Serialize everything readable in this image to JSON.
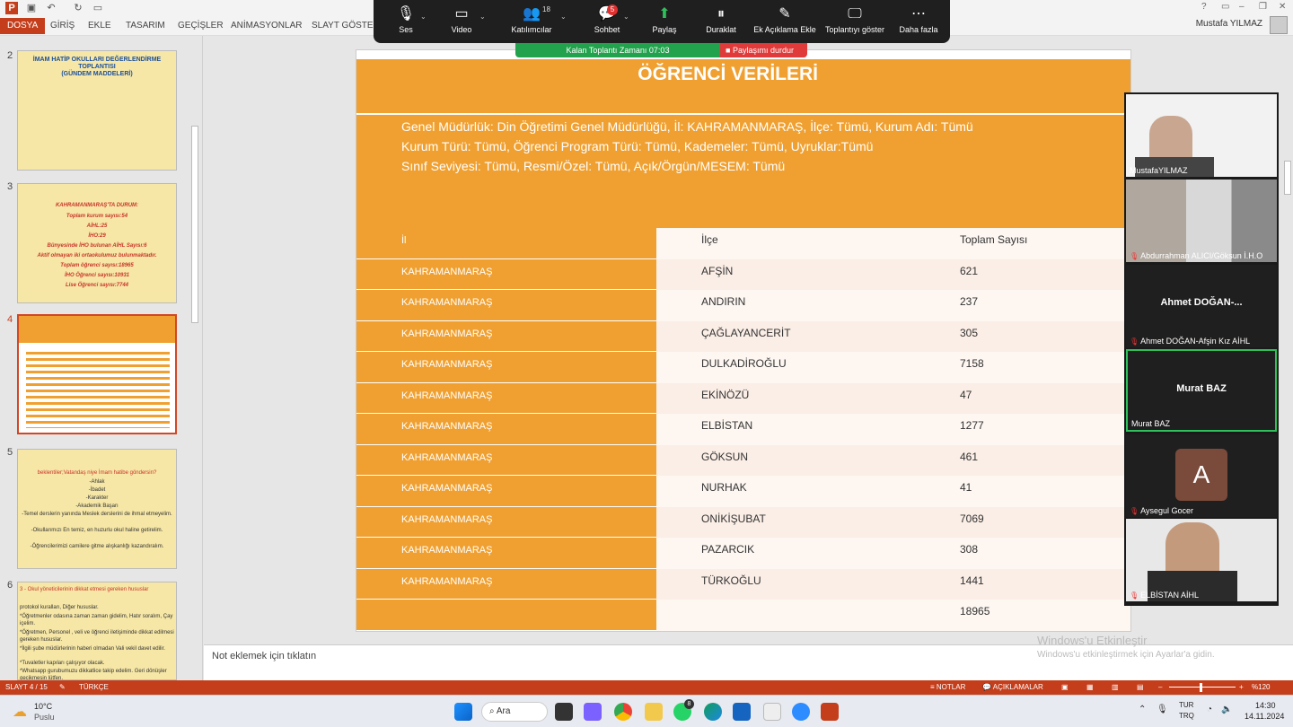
{
  "window": {
    "user_name": "Mustafa YILMAZ",
    "help": "?"
  },
  "ribbon": {
    "tabs": [
      "DOSYA",
      "GİRİŞ",
      "EKLE",
      "TASARIM",
      "GEÇİŞLER",
      "ANİMASYONLAR",
      "SLAYT GÖSTERİSİ"
    ]
  },
  "zoom": {
    "buttons": [
      {
        "label": "Ses",
        "icon": "microphone-icon",
        "glyph": "🎙"
      },
      {
        "label": "Video",
        "icon": "camera-icon",
        "glyph": "▭"
      },
      {
        "label": "Katılımcılar",
        "icon": "participants-icon",
        "glyph": "👥",
        "count": "18"
      },
      {
        "label": "Sohbet",
        "icon": "chat-icon",
        "glyph": "💬",
        "badge": "5"
      },
      {
        "label": "Paylaş",
        "icon": "share-icon",
        "glyph": "⬆"
      },
      {
        "label": "Duraklat",
        "icon": "pause-icon",
        "glyph": "⏸"
      },
      {
        "label": "Ek Açıklama Ekle",
        "icon": "annotate-icon",
        "glyph": "✎"
      },
      {
        "label": "Toplantıyı göster",
        "icon": "show-meeting-icon",
        "glyph": "🖵"
      },
      {
        "label": "Daha fazla",
        "icon": "more-icon",
        "glyph": "⋯"
      }
    ],
    "timer": "Kalan Toplantı Zamanı 07:03",
    "stop_share": "Paylaşımı durdur"
  },
  "thumbnails": [
    {
      "num": "2",
      "lines": [
        "İMAM HATİP OKULLARI DEĞERLENDİRME TOPLANTISI",
        "(GÜNDEM MADDELERİ)"
      ]
    },
    {
      "num": "3",
      "lines": [
        "KAHRAMANMARAŞ'TA DURUM:",
        "Toplam kurum sayısı:54",
        "AİHL:25",
        "İHO:29",
        "Bünyesinde İHO bulunan AİHL Sayısı:6",
        "Aktif olmayan iki ortaokulumuz bulunmaktadır.",
        "Toplam öğrenci sayısı:18965",
        "İHO Öğrenci sayısı:10931",
        "Lise Öğrenci sayısı:7744"
      ]
    },
    {
      "num": "4",
      "lines": []
    },
    {
      "num": "5",
      "lines": [
        "beklentiler;Vatandaş niye İmam hatibe göndersin?",
        "-Ahlak",
        "-İbadet",
        "-Karakter",
        "-Akademik Başarı",
        "-Temel derslerin yanında Meslek derslerini de ihmal etmeyelim.",
        "-Okullarımızı En temiz, en huzurlu okul haline getirelim.",
        "-Öğrencilerimizi camilere gitme alışkanlığı kazandıralım."
      ]
    },
    {
      "num": "6",
      "lines": [
        "3 - Okul yöneticilerinin dikkat etmesi gereken hususlar",
        "protokol kuralları, Diğer hususlar.",
        "*Öğretmenler odasına zaman zaman gidelim, Hatır soralım, Çay içelim.",
        "*Öğretmen, Personel , veli ve öğrenci iletişiminde dikkat edilmesi gereken hususlar.",
        "*İlgili şube müdürlerinin haberi olmadan Vali vekil davet edilir.",
        "*Tuvaletler kapıları çalışıyor olacak.",
        "*Whatsapp gurubumuzu dikkatlice takip edelim. Geri dönüşler gecikmesin lütfen."
      ]
    }
  ],
  "slide": {
    "title": "ÖĞRENCİ VERİLERİ",
    "subtitle_lines": [
      "Genel Müdürlük: Din Öğretimi Genel Müdürlüğü, İl: KAHRAMANMARAŞ, İlçe: Tümü, Kurum Adı: Tümü",
      "Kurum Türü: Tümü, Öğrenci Program Türü: Tümü, Kademeler: Tümü, Uyruklar:Tümü",
      "Sınıf Seviyesi: Tümü, Resmi/Özel: Tümü, Açık/Örgün/MESEM: Tümü"
    ],
    "headers": [
      "İl",
      "İlçe",
      "Toplam Sayısı"
    ],
    "rows": [
      [
        "KAHRAMANMARAŞ",
        "AFŞİN",
        "621"
      ],
      [
        "KAHRAMANMARAŞ",
        "ANDIRIN",
        "237"
      ],
      [
        "KAHRAMANMARAŞ",
        "ÇAĞLAYANCERİT",
        "305"
      ],
      [
        "KAHRAMANMARAŞ",
        "DULKADİROĞLU",
        "7158"
      ],
      [
        "KAHRAMANMARAŞ",
        "EKİNÖZÜ",
        "47"
      ],
      [
        "KAHRAMANMARAŞ",
        "ELBİSTAN",
        "1277"
      ],
      [
        "KAHRAMANMARAŞ",
        "GÖKSUN",
        "461"
      ],
      [
        "KAHRAMANMARAŞ",
        "NURHAK",
        "41"
      ],
      [
        "KAHRAMANMARAŞ",
        "ONİKİŞUBAT",
        "7069"
      ],
      [
        "KAHRAMANMARAŞ",
        "PAZARCIK",
        "308"
      ],
      [
        "KAHRAMANMARAŞ",
        "TÜRKOĞLU",
        "1441"
      ],
      [
        "",
        "",
        "18965"
      ]
    ]
  },
  "notes": {
    "placeholder": "Not eklemek için tıklatın"
  },
  "watermark": {
    "line1": "Windows'u Etkinleştir",
    "line2": "Windows'u etkinleştirmek için Ayarlar'a gidin."
  },
  "status": {
    "slide": "SLAYT 4 / 15",
    "lang": "TÜRKÇE",
    "notes": "NOTLAR",
    "comments": "AÇIKLAMALAR",
    "zoom": "%120"
  },
  "participants": [
    {
      "name": "MustafaYILMAZ",
      "type": "video",
      "muted": false
    },
    {
      "name": "Abdurrahman ALICI/Göksun İ.H.O",
      "type": "video",
      "muted": true
    },
    {
      "name": "Ahmet DOĞAN-Afşin Kız AİHL",
      "big": "Ahmet DOĞAN-...",
      "type": "name",
      "muted": true
    },
    {
      "name": "Murat BAZ",
      "big": "Murat BAZ",
      "type": "name",
      "muted": false
    },
    {
      "name": "Aysegul Gocer",
      "initial": "A",
      "type": "avatar",
      "muted": true
    },
    {
      "name": "ELBİSTAN AİHL",
      "type": "video",
      "muted": true
    }
  ],
  "taskbar": {
    "weather_temp": "10°C",
    "weather_desc": "Puslu",
    "search": "Ara",
    "lang1": "TUR",
    "lang2": "TRQ",
    "time": "14:30",
    "date": "14.11.2024",
    "whatsapp_badge": "8"
  },
  "colors": {
    "accent": "#c43e1c",
    "slide_orange": "#f0a030",
    "zoom_bg": "#1f1f1f",
    "timer_green": "#23a24d",
    "stop_red": "#e03a3a"
  }
}
